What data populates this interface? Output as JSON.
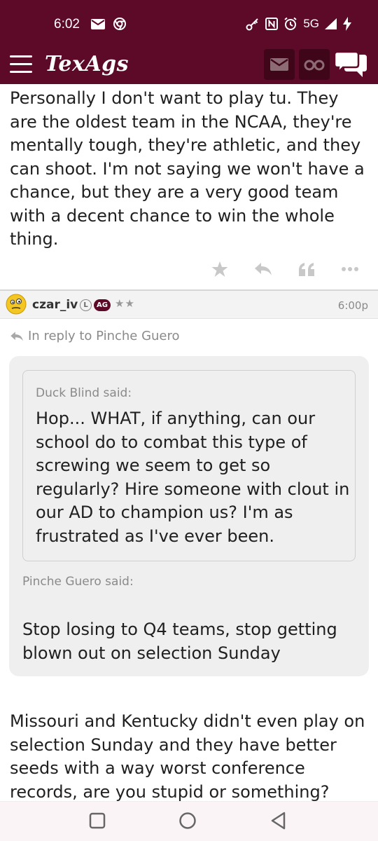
{
  "status_bar": {
    "time": "6:02",
    "left_icons": [
      "mail-icon",
      "chrome-icon"
    ],
    "right_icons": [
      "key-icon",
      "nfc-icon",
      "alarm-icon",
      "5g-icon",
      "signal-icon",
      "charging-icon"
    ],
    "network": "5G"
  },
  "app_bar": {
    "logo": "TexAgs",
    "icons": [
      "menu-icon",
      "mail-icon",
      "binoculars-icon",
      "chat-icon"
    ]
  },
  "post1": {
    "text": "Personally I don't want to play tu. They are the oldest team in the NCAA, they're mentally tough, they're athletic, and they can shoot. I'm not saying we won't have a chance, but they are a very good team with a decent chance to win the whole thing."
  },
  "post_actions": [
    "star-icon",
    "reply-icon",
    "quote-icon",
    "more-icon"
  ],
  "post2": {
    "username": "czar_iv",
    "badge_l": "L",
    "badge_ag": "AG",
    "stars": "★★",
    "time": "6:00p",
    "reply_to": "In reply to Pinche Guero",
    "inner_quote": {
      "author": "Duck Blind said:",
      "text": "Hop... WHAT, if anything, can our school do to combat this type of screwing we seem to get so regularly? Hire someone with clout in our AD to champion us? I'm as frustrated as I've ever been."
    },
    "outer_quote": {
      "author": "Pinche Guero said:",
      "text": "Stop losing to Q4 teams, stop getting blown out on selection Sunday"
    },
    "body": "Missouri and Kentucky didn't even play on selection Sunday and they have better seeds with a way worst conference records, are you stupid or something?"
  },
  "colors": {
    "brand": "#5c0a28",
    "brand_dark": "#3f0619",
    "muted_text": "#8a8a8a",
    "quote_bg": "#efefef"
  }
}
